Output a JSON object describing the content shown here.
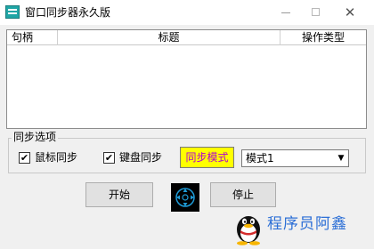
{
  "window": {
    "title": "窗口同步器永久版",
    "close_glyph": "✕"
  },
  "list": {
    "columns": [
      "句柄",
      "标题",
      "操作类型"
    ],
    "rows": []
  },
  "options": {
    "group_label": "同步选项",
    "mouse_sync": {
      "label": "鼠标同步",
      "checked": true,
      "mark": "✔"
    },
    "keyboard_sync": {
      "label": "键盘同步",
      "checked": true,
      "mark": "✔"
    },
    "sync_mode_button": "同步模式",
    "mode_select": {
      "value": "模式1",
      "arrow": "▼"
    }
  },
  "actions": {
    "start": "开始",
    "stop": "停止"
  },
  "watermark": {
    "text": "程序员阿鑫"
  },
  "colors": {
    "sync_mode_bg": "#ffff00",
    "sync_mode_text": "#b000d0",
    "watermark_text": "#2c6fd6",
    "app_icon": "#1fa6a6"
  }
}
